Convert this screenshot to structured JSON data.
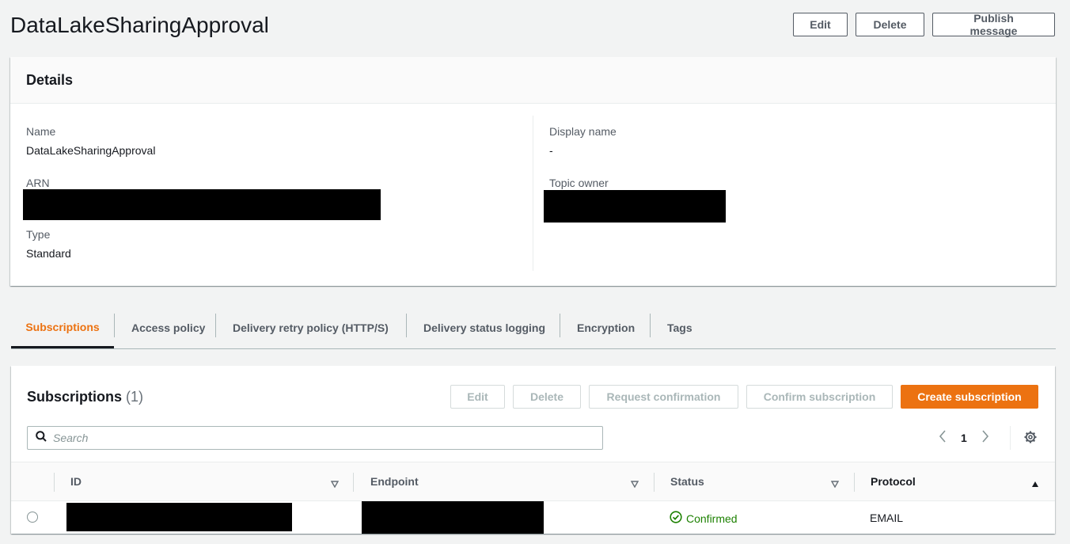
{
  "header": {
    "title": "DataLakeSharingApproval",
    "edit_label": "Edit",
    "delete_label": "Delete",
    "publish_label": "Publish message"
  },
  "details": {
    "heading": "Details",
    "name_label": "Name",
    "name_value": "DataLakeSharingApproval",
    "arn_label": "ARN",
    "type_label": "Type",
    "type_value": "Standard",
    "display_name_label": "Display name",
    "display_name_value": "-",
    "topic_owner_label": "Topic owner"
  },
  "tabs": [
    {
      "label": "Subscriptions",
      "active": true
    },
    {
      "label": "Access policy",
      "active": false
    },
    {
      "label": "Delivery retry policy (HTTP/S)",
      "active": false
    },
    {
      "label": "Delivery status logging",
      "active": false
    },
    {
      "label": "Encryption",
      "active": false
    },
    {
      "label": "Tags",
      "active": false
    }
  ],
  "subscriptions": {
    "title": "Subscriptions",
    "count": "(1)",
    "buttons": {
      "edit": "Edit",
      "delete": "Delete",
      "request_confirmation": "Request confirmation",
      "confirm_subscription": "Confirm subscription",
      "create_subscription": "Create subscription"
    },
    "search_placeholder": "Search",
    "page": "1",
    "columns": [
      "ID",
      "Endpoint",
      "Status",
      "Protocol"
    ],
    "rows": [
      {
        "status": "Confirmed",
        "protocol": "EMAIL"
      }
    ]
  },
  "colors": {
    "accent": "#ec7211",
    "success": "#1d8102",
    "text": "#16191f",
    "muted": "#545b64",
    "background": "#f2f3f3"
  }
}
